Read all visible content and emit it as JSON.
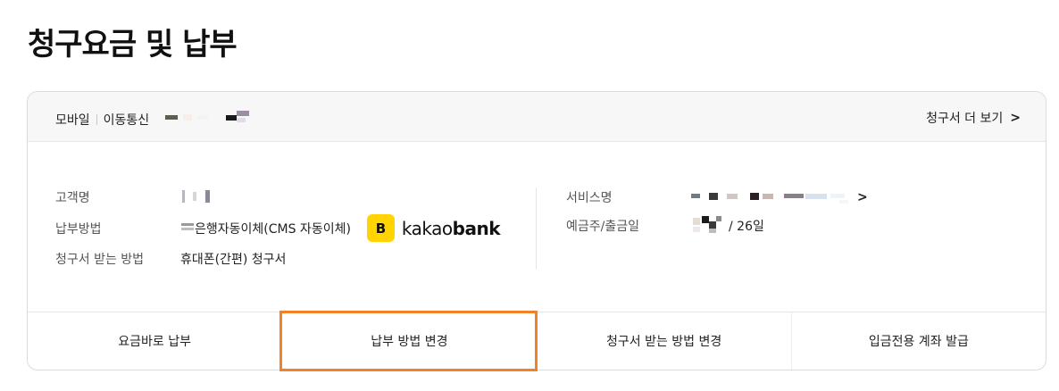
{
  "page": {
    "title": "청구요금 및 납부"
  },
  "header": {
    "category": "모바일",
    "service_type": "이동통신",
    "view_bills_label": "청구서 더 보기",
    "chevron": ">"
  },
  "info": {
    "customer_label": "고객명",
    "payment_method_label": "납부방법",
    "payment_method_value": "은행자동이체(CMS 자동이체)",
    "bank_name_prefix": "kakao",
    "bank_name_suffix": "bank",
    "bank_logo_letter": "B",
    "bill_receive_label": "청구서 받는 방법",
    "bill_receive_value": "휴대폰(간편) 청구서",
    "service_name_label": "서비스명",
    "deposit_label": "예금주/출금일",
    "deposit_day": "/ 26일"
  },
  "actions": [
    {
      "label": "요금바로 납부"
    },
    {
      "label": "납부 방법 변경"
    },
    {
      "label": "청구서 받는 방법 변경"
    },
    {
      "label": "입금전용 계좌 발급"
    }
  ],
  "colors": {
    "highlight": "#f08228",
    "kakao_yellow": "#ffd400"
  }
}
